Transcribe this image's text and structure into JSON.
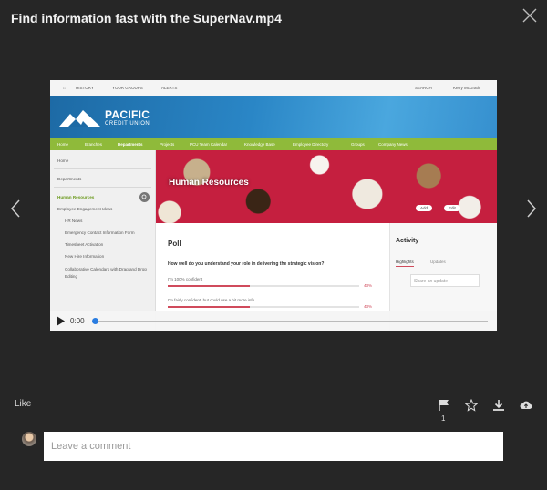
{
  "dialog": {
    "title": "Find information fast with the SuperNav.mp4"
  },
  "video": {
    "suitebar": {
      "history": "HISTORY",
      "groups": "YOUR GROUPS",
      "alerts": "ALERTS",
      "search": "SEARCH",
      "user": "Kerry McGrath"
    },
    "brand": {
      "name": "PACIFIC",
      "sub": "CREDIT UNION"
    },
    "nav": [
      "Home",
      "Branches",
      "Departments",
      "Projects",
      "PCU Team Calendar",
      "Knowledge Base",
      "Employee Directory",
      "Groups",
      "Company News"
    ],
    "sidebar": {
      "home": "Home",
      "departments": "Departments",
      "current": "Human Resources",
      "items": [
        "Employee Engagement Ideas",
        "HR News",
        "Emergency Contact Information Form",
        "Timesheet Activation",
        "New Hire Information",
        "Collaborative Calendars with Drag and Drop Editing"
      ]
    },
    "hero": {
      "title": "Human Resources",
      "add": "Add",
      "edit": "Edit"
    },
    "poll": {
      "title": "Poll",
      "question": "How well do you understand your role in delivering the strategic vision?",
      "options": [
        {
          "label": "I'm 100% confident",
          "percent": 43,
          "pct_label": "43%"
        },
        {
          "label": "I'm fairly confident, but could use a bit more info.",
          "percent": 43,
          "pct_label": "43%"
        }
      ]
    },
    "activity": {
      "title": "Activity",
      "tabs": [
        "Highlights",
        "Updates"
      ],
      "share_placeholder": "Share an update"
    },
    "player": {
      "time": "0:00",
      "progress": 0
    }
  },
  "actions": {
    "like": "Like",
    "flag_count": "1"
  },
  "comment": {
    "placeholder": "Leave a comment"
  },
  "colors": {
    "background": "#262626",
    "nav_green": "#8fba3a",
    "brand_blue": "#2a86c6",
    "poll_red": "#d04b5c"
  }
}
